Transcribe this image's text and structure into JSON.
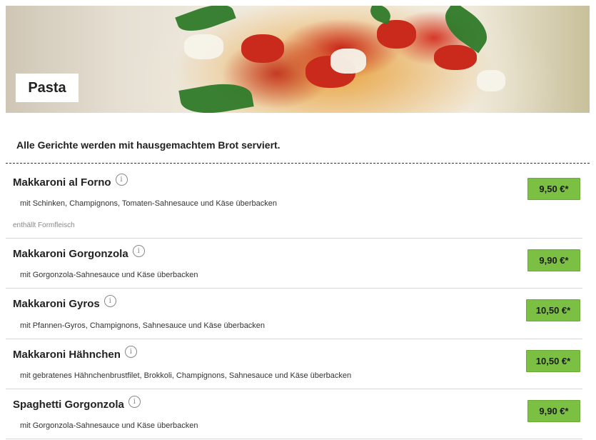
{
  "section": {
    "title": "Pasta",
    "notice": "Alle Gerichte werden mit hausgemachtem Brot serviert."
  },
  "info_icon_glyph": "i",
  "items": [
    {
      "name": "Makkaroni al Forno",
      "description": "mit Schinken, Champignons, Tomaten-Sahnesauce und Käse überbacken",
      "note": "enthällt Formfleisch",
      "price": "9,50 €*"
    },
    {
      "name": "Makkaroni Gorgonzola",
      "description": "mit Gorgonzola-Sahnesauce und Käse überbacken",
      "price": "9,90 €*"
    },
    {
      "name": "Makkaroni Gyros",
      "description": "mit Pfannen-Gyros, Champignons, Sahnesauce und Käse überbacken",
      "price": "10,50 €*"
    },
    {
      "name": "Makkaroni Hähnchen",
      "description": "mit gebratenes Hähnchenbrustfilet, Brokkoli, Champignons, Sahnesauce und Käse überbacken",
      "price": "10,50 €*"
    },
    {
      "name": "Spaghetti Gorgonzola",
      "description": "mit Gorgonzola-Sahnesauce und Käse überbacken",
      "price": "9,90 €*"
    }
  ],
  "colors": {
    "price_button": "#7cc043",
    "separator": "#d6d6d6"
  }
}
